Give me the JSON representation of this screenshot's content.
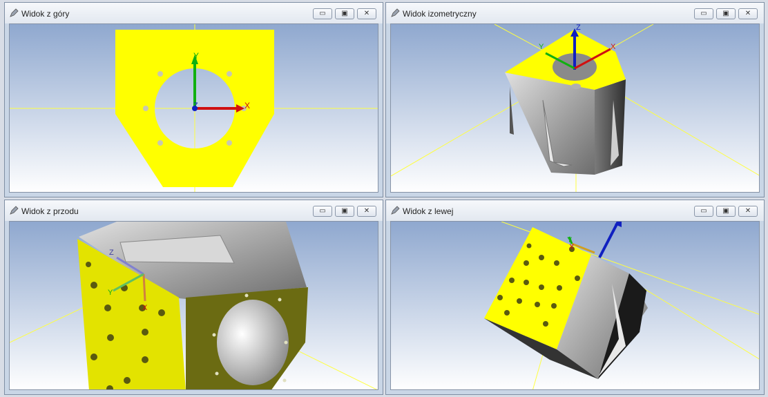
{
  "windows": [
    {
      "title": "Widok z góry"
    },
    {
      "title": "Widok izometryczny"
    },
    {
      "title": "Widok z przodu"
    },
    {
      "title": "Widok z lewej"
    }
  ],
  "axes": {
    "x": "X",
    "y": "Y",
    "z": "Z"
  },
  "colors": {
    "yellow_face": "#ffff00",
    "olive_face": "#6b6b12",
    "sky_top": "#8fa8cf",
    "sky_bottom": "#ffffff",
    "axis_x": "#d01010",
    "axis_y": "#10b010",
    "axis_z": "#1020c0"
  },
  "icons": {
    "app": "pen-icon",
    "minimize": "minimize-icon",
    "maximize": "maximize-icon",
    "close": "close-icon"
  }
}
